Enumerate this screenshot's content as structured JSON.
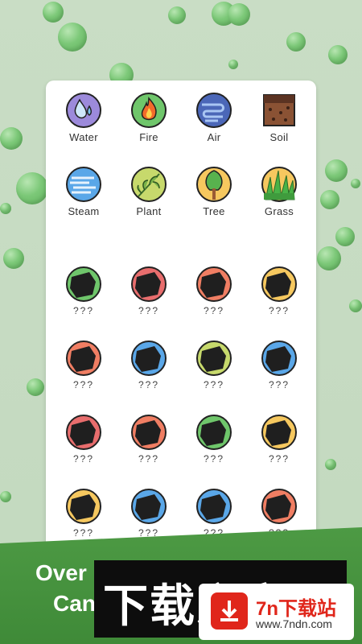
{
  "elements_row1": [
    {
      "label": "Water",
      "icon": "water-drops-icon"
    },
    {
      "label": "Fire",
      "icon": "fire-icon"
    },
    {
      "label": "Air",
      "icon": "air-swirl-icon"
    },
    {
      "label": "Soil",
      "icon": "soil-icon"
    }
  ],
  "elements_row2": [
    {
      "label": "Steam",
      "icon": "steam-icon"
    },
    {
      "label": "Plant",
      "icon": "plant-leaf-icon"
    },
    {
      "label": "Tree",
      "icon": "tree-icon"
    },
    {
      "label": "Grass",
      "icon": "grass-icon"
    }
  ],
  "locked_label": "???",
  "locked_rows": [
    [
      "#6fc66b",
      "#e86d6d",
      "#f07e63",
      "#f6c85f"
    ],
    [
      "#f07e63",
      "#5aa7e8",
      "#c7d96c",
      "#5aa7e8"
    ],
    [
      "#e86d6d",
      "#f07e63",
      "#6fc66b",
      "#f6c85f"
    ],
    [
      "#f6c85f",
      "#5aa7e8",
      "#5aa7e8",
      "#f07e63"
    ]
  ],
  "banner": {
    "line1": "Over",
    "line2": "Can"
  },
  "watermark": {
    "text": "下载之家",
    "site": "7n下载站",
    "url": "www.7ndn.com"
  },
  "colors": {
    "banner_green": "#4d9a44",
    "watermark_red": "#e0261b"
  }
}
